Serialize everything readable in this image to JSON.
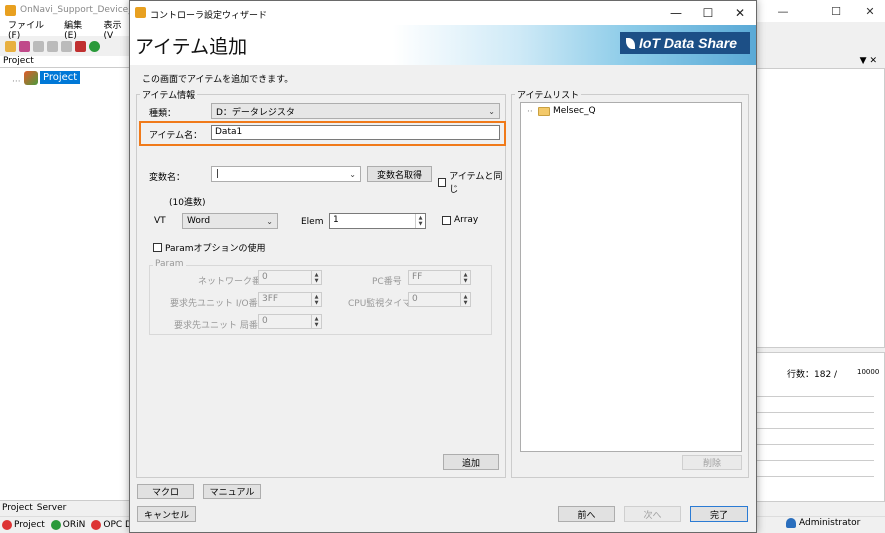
{
  "background_app": {
    "title": "OnNavi_Support_Device_PLC",
    "menu": [
      "ファイル(F)",
      "編集(E)",
      "表示(V"
    ],
    "panel_title": "Project",
    "tree_root": "Project",
    "tabs": [
      "Project",
      "Server"
    ],
    "status_items": [
      "Project",
      "ORiN",
      "OPC DA"
    ],
    "user": "Administrator",
    "row_count_label": "行数：182 /",
    "row_count_max": "10000"
  },
  "dialog": {
    "window_title": "コントローラ設定ウィザード",
    "heading": "アイテム追加",
    "brand": "IoT Data Share",
    "info_text": "この画面でアイテムを追加できます。",
    "item_info_group": "アイテム情報",
    "type_label": "種類：",
    "type_value": "D：データレジスタ",
    "item_name_label": "アイテム名：",
    "item_name_value": "Data1",
    "var_name_label": "変数名：",
    "var_name_value": "",
    "get_var_button": "変数名取得",
    "same_as_item_label": "アイテムと同じ",
    "radix_label": "(10進数)",
    "vt_label": "VT",
    "vt_value": "Word",
    "elem_label": "Elem",
    "elem_value": "1",
    "array_label": "Array",
    "param_option_label": "Paramオプションの使用",
    "param_group": "Param",
    "network_no_label": "ネットワーク番号",
    "network_no_value": "0",
    "pc_no_label": "PC番号",
    "pc_no_value": "FF",
    "req_unit_io_label": "要求先ユニット I/O番号",
    "req_unit_io_value": "3FF",
    "cpu_timer_label": "CPU監視タイマ",
    "cpu_timer_value": "0",
    "req_unit_station_label": "要求先ユニット 局番号",
    "req_unit_station_value": "0",
    "add_button": "追加",
    "item_list_group": "アイテムリスト",
    "item_list": [
      "Melsec_Q"
    ],
    "delete_button": "削除",
    "macro_button": "マクロ",
    "manual_button": "マニュアル",
    "cancel_button": "キャンセル",
    "prev_button": "前へ",
    "next_button": "次へ",
    "finish_button": "完了"
  }
}
